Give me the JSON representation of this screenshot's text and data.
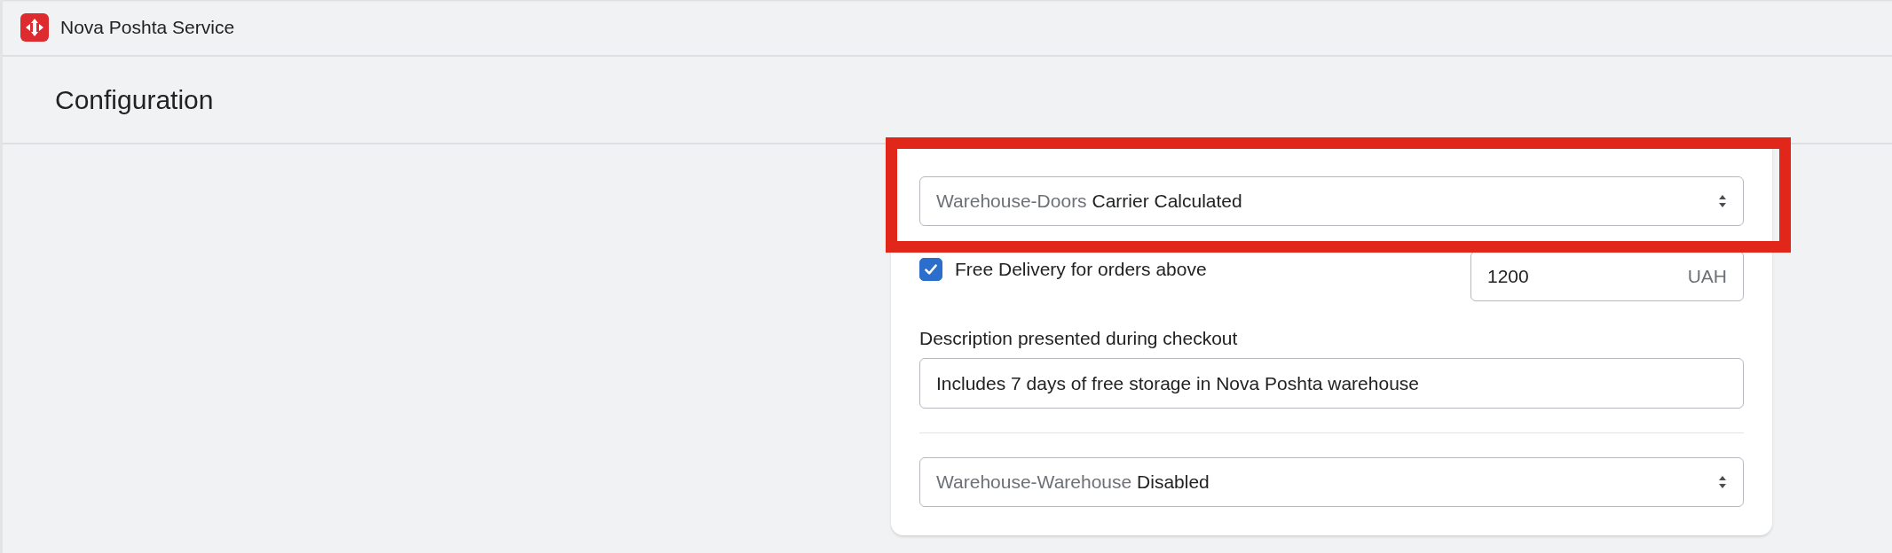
{
  "app": {
    "title": "Nova Poshta Service"
  },
  "page": {
    "title": "Configuration"
  },
  "methods": [
    {
      "kind": "select",
      "label": "Warehouse-Doors",
      "value": "Carrier Calculated",
      "highlighted": true
    },
    {
      "kind": "free_delivery",
      "label": "Free Delivery for orders above",
      "checked": true,
      "amount": "1200",
      "currency": "UAH"
    },
    {
      "kind": "description",
      "label": "Description presented during checkout",
      "value": "Includes 7 days of free storage in Nova Poshta warehouse"
    },
    {
      "kind": "divider"
    },
    {
      "kind": "select",
      "label": "Warehouse-Warehouse",
      "value": "Disabled",
      "highlighted": false
    }
  ]
}
